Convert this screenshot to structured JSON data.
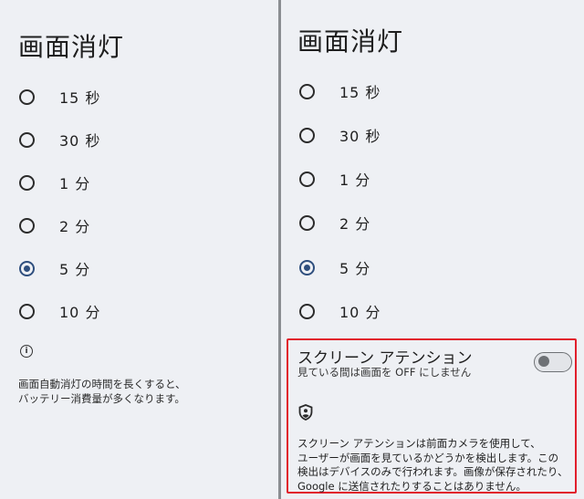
{
  "left_panel": {
    "title": "画面消灯",
    "options": [
      {
        "label": "15 秒",
        "selected": false
      },
      {
        "label": "30 秒",
        "selected": false
      },
      {
        "label": "1 分",
        "selected": false
      },
      {
        "label": "2 分",
        "selected": false
      },
      {
        "label": "5 分",
        "selected": true
      },
      {
        "label": "10 分",
        "selected": false
      }
    ],
    "info_icon": "info-icon",
    "note": "画面自動消灯の時間を長くすると、\nバッテリー消費量が多くなります。"
  },
  "right_panel": {
    "title": "画面消灯",
    "options": [
      {
        "label": "15 秒",
        "selected": false
      },
      {
        "label": "30 秒",
        "selected": false
      },
      {
        "label": "1 分",
        "selected": false
      },
      {
        "label": "2 分",
        "selected": false
      },
      {
        "label": "5 分",
        "selected": true
      },
      {
        "label": "10 分",
        "selected": false
      }
    ],
    "screen_attention": {
      "title": "スクリーン アテンション",
      "subtitle": "見ている間は画面を OFF にしません",
      "toggle_on": false,
      "privacy_icon": "shield-person-icon",
      "description": "スクリーン アテンションは前面カメラを使用して、\nユーザーが画面を見ているかどうかを検出します。この\n検出はデバイスのみで行われます。画像が保存されたり、\nGoogle に送信されたりすることはありません。"
    }
  },
  "colors": {
    "background": "#eef0f4",
    "divider": "#8b8e92",
    "radio_selected": "#2f4f7e",
    "highlight_border": "#e11f2c"
  }
}
